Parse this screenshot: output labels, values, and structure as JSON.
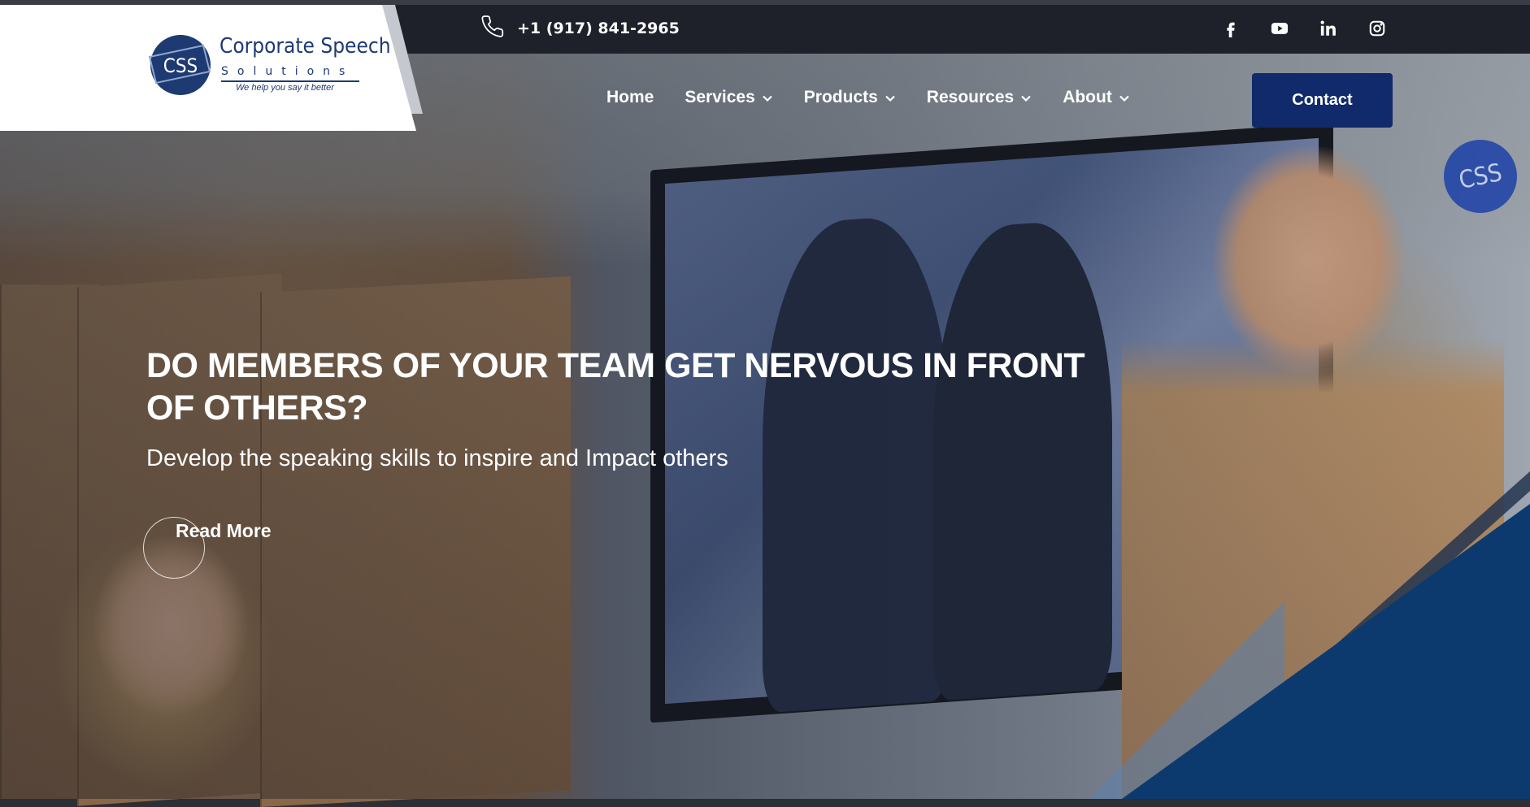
{
  "topbar": {
    "phone": "+1 (917) 841-2965",
    "social": [
      {
        "icon": "facebook-icon"
      },
      {
        "icon": "youtube-icon"
      },
      {
        "icon": "linkedin-icon"
      },
      {
        "icon": "instagram-icon"
      }
    ]
  },
  "logo": {
    "badge": "CSS",
    "name": "Corporate Speech",
    "sub": "Solutions",
    "tagline": "We help you say it better"
  },
  "nav": {
    "items": [
      {
        "label": "Home",
        "has_dropdown": false
      },
      {
        "label": "Services",
        "has_dropdown": true
      },
      {
        "label": "Products",
        "has_dropdown": true
      },
      {
        "label": "Resources",
        "has_dropdown": true
      },
      {
        "label": "About",
        "has_dropdown": true
      }
    ],
    "contact_label": "Contact"
  },
  "hero": {
    "title": "DO MEMBERS OF YOUR TEAM GET NERVOUS IN FRONT OF OTHERS?",
    "subtitle": "Develop the speaking skills to inspire and Impact others",
    "cta": "Read More",
    "watermark_badge": "CSS"
  },
  "colors": {
    "topbar_bg": "#1e2129",
    "brand_navy": "#102a6b",
    "logo_blue": "#1e3a73",
    "accent_navy": "#0c3a6e"
  }
}
